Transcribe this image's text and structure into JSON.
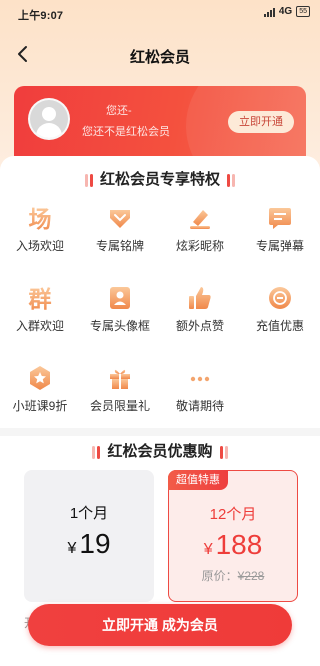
{
  "status_bar": {
    "time": "上午9:07",
    "network": "4G",
    "battery": "55"
  },
  "nav": {
    "title": "红松会员"
  },
  "member_card": {
    "name": "您还-",
    "status": "您还不是红松会员",
    "open_button": "立即开通"
  },
  "privileges": {
    "title": "红松会员专享特权",
    "items": [
      {
        "label": "入场欢迎",
        "icon": "venue-welcome-icon"
      },
      {
        "label": "专属铭牌",
        "icon": "badge-nameplate-icon"
      },
      {
        "label": "炫彩昵称",
        "icon": "colorful-nickname-icon"
      },
      {
        "label": "专属弹幕",
        "icon": "danmaku-icon"
      },
      {
        "label": "入群欢迎",
        "icon": "group-welcome-icon"
      },
      {
        "label": "专属头像框",
        "icon": "avatar-frame-icon"
      },
      {
        "label": "额外点赞",
        "icon": "thumbs-up-icon"
      },
      {
        "label": "充值优惠",
        "icon": "coin-discount-icon"
      },
      {
        "label": "小班课9折",
        "icon": "star-class-icon"
      },
      {
        "label": "会员限量礼",
        "icon": "gift-icon"
      },
      {
        "label": "敬请期待",
        "icon": "more-dots-icon"
      }
    ]
  },
  "offers": {
    "title": "红松会员优惠购",
    "plans": [
      {
        "duration": "1个月",
        "currency": "¥",
        "price": "19"
      },
      {
        "tag": "超值特惠",
        "duration": "12个月",
        "currency": "¥",
        "price": "188",
        "original_label": "原价：",
        "original_price": "¥228"
      }
    ],
    "peek_text": "开"
  },
  "cta": {
    "label": "立即开通 成为会员"
  },
  "colors": {
    "accent": "#ee3d3a",
    "icon_gradient_start": "#fbc28f",
    "icon_gradient_end": "#f08a4b"
  }
}
